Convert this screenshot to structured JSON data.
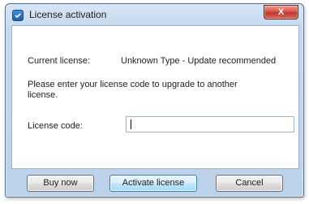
{
  "window": {
    "title": "License activation",
    "close_label": "X"
  },
  "content": {
    "current_license_label": "Current license:",
    "current_license_value": "Unknown Type - Update recommended",
    "instruction": "Please enter your license code to upgrade to another license.",
    "license_code_label": "License code:",
    "license_code_value": "",
    "license_code_placeholder": ""
  },
  "buttons": {
    "buy_now": "Buy now",
    "activate": "Activate license",
    "cancel": "Cancel"
  }
}
